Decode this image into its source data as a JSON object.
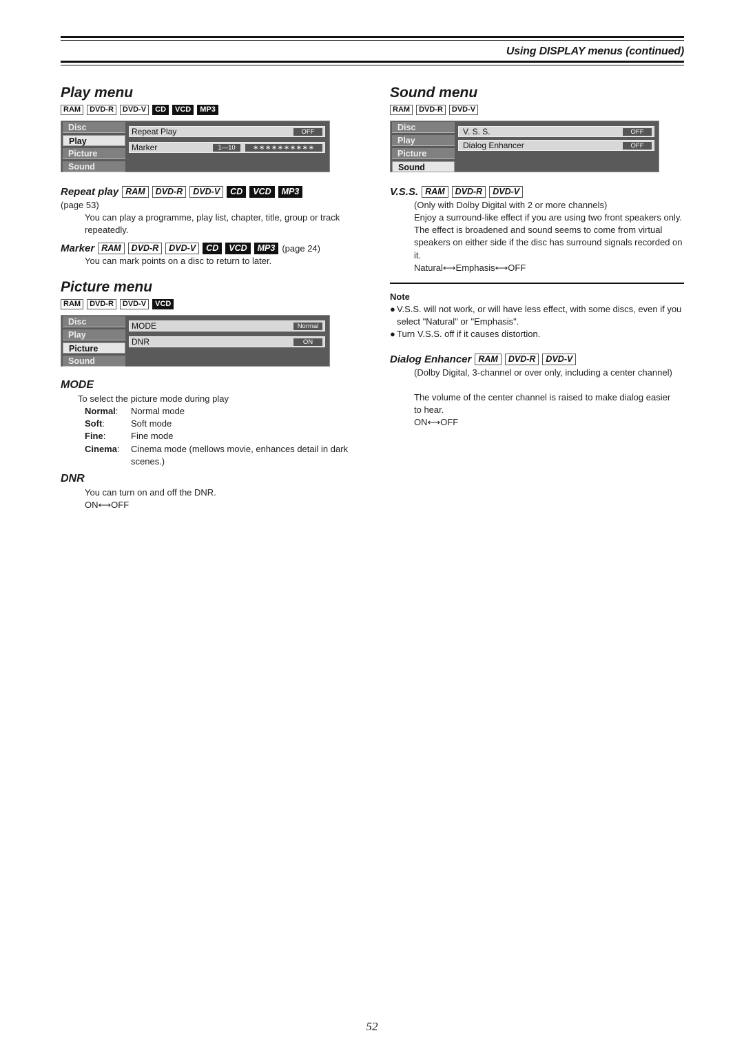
{
  "header": {
    "title": "Using DISPLAY menus (continued)"
  },
  "play_menu": {
    "title": "Play menu",
    "badges": [
      {
        "label": "RAM",
        "inverted": false
      },
      {
        "label": "DVD-R",
        "inverted": false
      },
      {
        "label": "DVD-V",
        "inverted": false
      },
      {
        "label": "CD",
        "inverted": true
      },
      {
        "label": "VCD",
        "inverted": true
      },
      {
        "label": "MP3",
        "inverted": true
      }
    ],
    "osd": {
      "tabs": [
        "Disc",
        "Play",
        "Picture",
        "Sound"
      ],
      "active_tab": "Play",
      "rows": [
        {
          "label": "Repeat Play",
          "value": "OFF"
        },
        {
          "label": "Marker",
          "range": "1—10",
          "value": "∗∗∗∗∗∗∗∗∗∗"
        }
      ]
    },
    "repeat_play": {
      "title": "Repeat play",
      "page_ref": "(page 53)",
      "text": "You can play a programme, play list, chapter, title, group or track repeatedly."
    },
    "marker": {
      "title": "Marker",
      "page_ref": "(page 24)",
      "text": "You can mark points on a disc to return to later."
    }
  },
  "picture_menu": {
    "title": "Picture menu",
    "badges": [
      {
        "label": "RAM",
        "inverted": false
      },
      {
        "label": "DVD-R",
        "inverted": false
      },
      {
        "label": "DVD-V",
        "inverted": false
      },
      {
        "label": "VCD",
        "inverted": true
      }
    ],
    "osd": {
      "tabs": [
        "Disc",
        "Play",
        "Picture",
        "Sound"
      ],
      "active_tab": "Picture",
      "rows": [
        {
          "label": "MODE",
          "value": "Normal"
        },
        {
          "label": "DNR",
          "value": "ON"
        }
      ]
    },
    "mode": {
      "title": "MODE",
      "intro": "To select the picture mode during play",
      "options": [
        {
          "key": "Normal",
          "desc": "Normal mode"
        },
        {
          "key": "Soft",
          "desc": "Soft mode"
        },
        {
          "key": "Fine",
          "desc": "Fine mode"
        },
        {
          "key": "Cinema",
          "desc": "Cinema mode (mellows movie, enhances detail in dark scenes.)"
        }
      ]
    },
    "dnr": {
      "title": "DNR",
      "text": "You can turn on and off the DNR.",
      "cycle": "ON⟷OFF"
    }
  },
  "sound_menu": {
    "title": "Sound menu",
    "badges": [
      {
        "label": "RAM",
        "inverted": false
      },
      {
        "label": "DVD-R",
        "inverted": false
      },
      {
        "label": "DVD-V",
        "inverted": false
      }
    ],
    "osd": {
      "tabs": [
        "Disc",
        "Play",
        "Picture",
        "Sound"
      ],
      "active_tab": "Sound",
      "rows": [
        {
          "label": "V. S. S.",
          "value": "OFF"
        },
        {
          "label": "Dialog Enhancer",
          "value": "OFF"
        }
      ]
    },
    "vss": {
      "title": "V.S.S.",
      "condition": "(Only with Dolby Digital with 2 or more channels)",
      "text": "Enjoy a surround-like effect if you are using two front speakers only. The effect is broadened and sound seems to come from virtual speakers on either side if the disc has surround signals recorded on it.",
      "cycle": "Natural⟷Emphasis⟷OFF"
    },
    "note": {
      "title": "Note",
      "bullets": [
        "V.S.S. will not work, or will have less effect, with some discs, even if you select \"Natural\" or \"Emphasis\".",
        "Turn V.S.S. off if it causes distortion."
      ]
    },
    "dialog_enhancer": {
      "title": "Dialog Enhancer",
      "condition": "(Dolby Digital, 3-channel or over only, including a center channel)",
      "text": "The volume of the center channel is raised to make dialog easier to hear.",
      "cycle": "ON⟷OFF"
    }
  },
  "footer": {
    "page_number": "52"
  }
}
